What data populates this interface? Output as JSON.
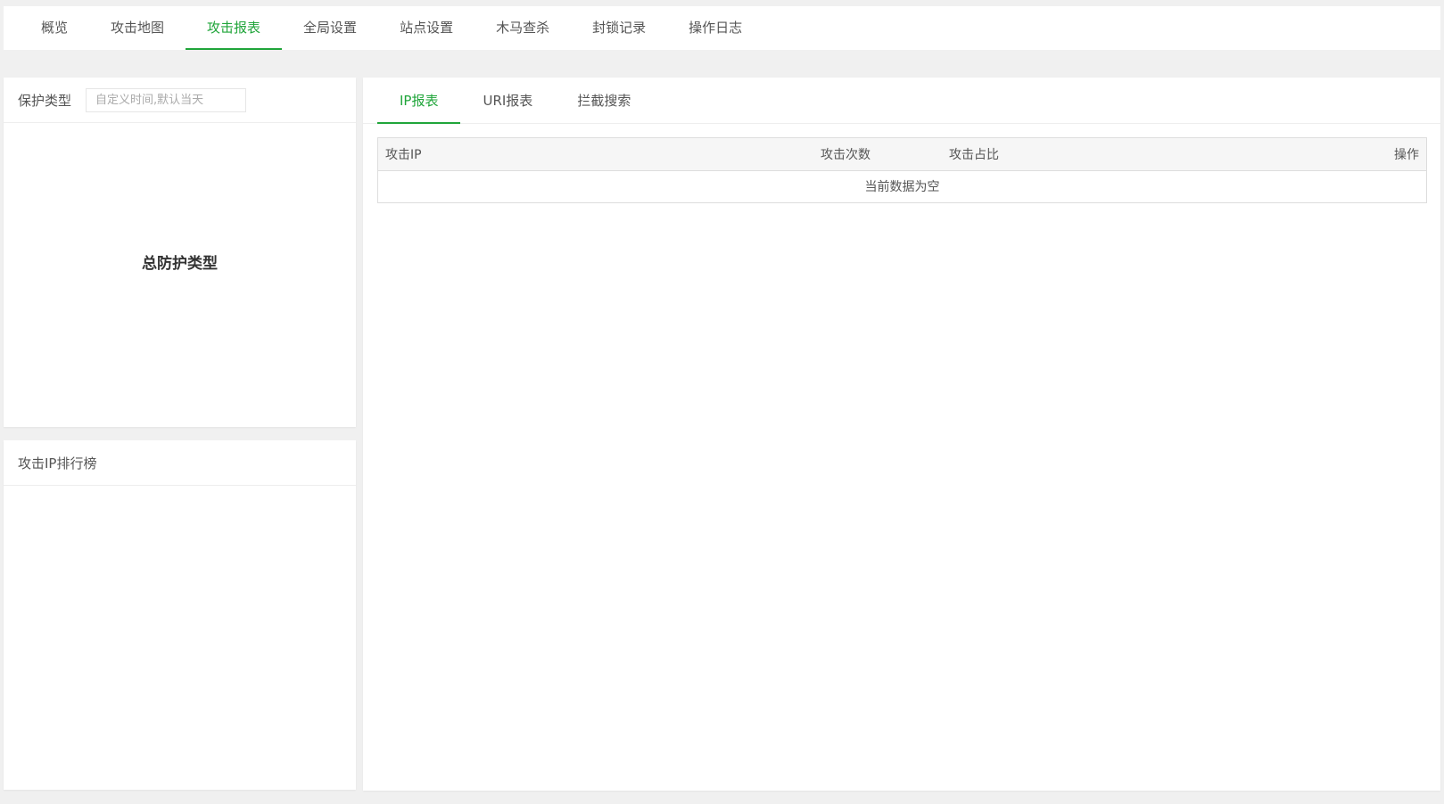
{
  "topnav": {
    "items": [
      {
        "label": "概览"
      },
      {
        "label": "攻击地图"
      },
      {
        "label": "攻击报表",
        "active": true
      },
      {
        "label": "全局设置"
      },
      {
        "label": "站点设置"
      },
      {
        "label": "木马查杀"
      },
      {
        "label": "封锁记录"
      },
      {
        "label": "操作日志"
      }
    ]
  },
  "protection": {
    "title": "保护类型",
    "date_placeholder": "自定义时间,默认当天",
    "chart_title": "总防护类型"
  },
  "ranking": {
    "title": "攻击IP排行榜"
  },
  "report": {
    "tabs": [
      {
        "label": "IP报表",
        "active": true
      },
      {
        "label": "URI报表"
      },
      {
        "label": "拦截搜索"
      }
    ],
    "table": {
      "headers": {
        "ip": "攻击IP",
        "count": "攻击次数",
        "ratio": "攻击占比",
        "op": "操作"
      },
      "empty_text": "当前数据为空"
    }
  },
  "colors": {
    "accent": "#20a53a",
    "background": "#f0f0f0"
  }
}
